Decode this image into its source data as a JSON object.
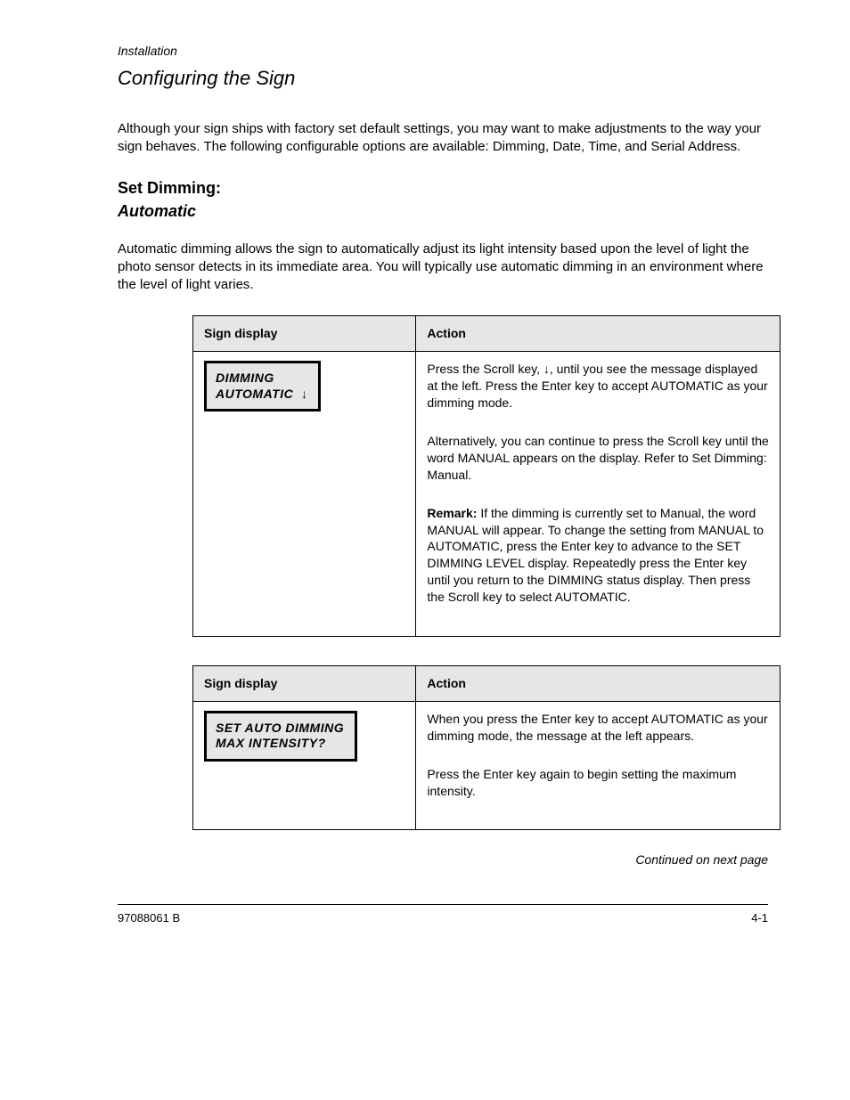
{
  "header": {
    "running": "Installation",
    "large": "Configuring the Sign"
  },
  "intro": {
    "section_outer": "Set Dimming:",
    "section_inner": "Automatic",
    "p1": "Although your sign ships with factory set default settings, you may want to make adjustments to the way your sign behaves. The following configurable options are available: Dimming, Date, Time, and Serial Address.",
    "p2": "Automatic dimming allows the sign to automatically adjust its light intensity based upon the level of light the photo sensor detects in its immediate area. You will typically use automatic dimming in an environment where the level of light varies."
  },
  "table1": {
    "hd_display": "Sign display",
    "hd_action": "Action",
    "lcd_line1": "DIMMING",
    "lcd_line2": "AUTOMATIC  ↓",
    "action1a": "Press the Scroll key, ",
    "action1b": ", until you see the message displayed at the left. Press the Enter key to accept AUTOMATIC as your dimming mode.",
    "action2": "Alternatively, you can continue to press the Scroll key until the word MANUAL appears on the display. Refer to Set Dimming: Manual.",
    "action_remark": "Remark:",
    "action3": " If the dimming is currently set to Manual, the word MANUAL will appear. To change the setting from MANUAL to AUTOMATIC, press the Enter key to advance to the SET DIMMING LEVEL display. Repeatedly press the Enter key until you return to the DIMMING status display. Then press the Scroll key to select AUTOMATIC."
  },
  "table2": {
    "hd_display": "Sign display",
    "hd_action": "Action",
    "lcd_line1": "SET AUTO DIMMING",
    "lcd_line2": "MAX INTENSITY?",
    "action1": "When you press the Enter key to accept AUTOMATIC as your dimming mode, the message at the left appears.",
    "action2": "Press the Enter key again to begin setting the maximum intensity."
  },
  "continued": "Continued on next page",
  "footer": {
    "left": "97088061 B",
    "right": "4-1"
  }
}
